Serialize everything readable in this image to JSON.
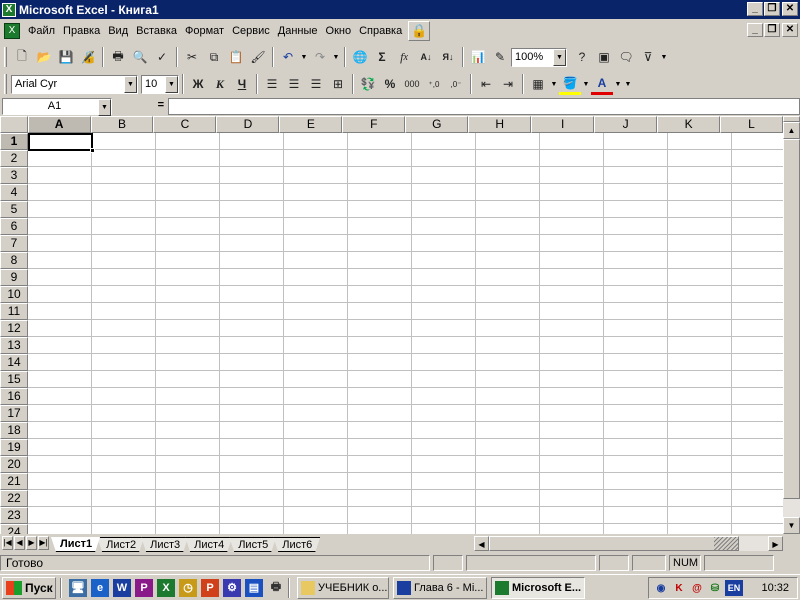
{
  "window": {
    "title": "Microsoft Excel - Книга1",
    "app_icon": "excel-icon"
  },
  "menu": {
    "items": [
      "Файл",
      "Правка",
      "Вид",
      "Вставка",
      "Формат",
      "Сервис",
      "Данные",
      "Окно",
      "Справка"
    ]
  },
  "standard_toolbar": {
    "zoom": "100%"
  },
  "formatting_toolbar": {
    "font_name": "Arial Cyr",
    "font_size": "10",
    "bold_label": "Ж",
    "italic_label": "К",
    "underline_label": "Ч",
    "percent_label": "%",
    "thousands_label": "000"
  },
  "formula_bar": {
    "name_box": "A1",
    "equals": "=",
    "content": ""
  },
  "grid": {
    "columns": [
      "A",
      "B",
      "C",
      "D",
      "E",
      "F",
      "G",
      "H",
      "I",
      "J",
      "K",
      "L"
    ],
    "rows": [
      "1",
      "2",
      "3",
      "4",
      "5",
      "6",
      "7",
      "8",
      "9",
      "10",
      "11",
      "12",
      "13",
      "14",
      "15",
      "16",
      "17",
      "18",
      "19",
      "20",
      "21",
      "22",
      "23",
      "24"
    ],
    "active_cell": "A1"
  },
  "sheet_tabs": [
    "Лист1",
    "Лист2",
    "Лист3",
    "Лист4",
    "Лист5",
    "Лист6"
  ],
  "active_sheet": "Лист1",
  "status": {
    "text": "Готово",
    "num": "NUM"
  },
  "taskbar": {
    "start_label": "Пуск",
    "buttons": [
      "УЧЕБНИК о...",
      "Глава 6 - Mi...",
      "Microsoft E..."
    ],
    "active_button": "Microsoft E...",
    "tray_lang": "EN",
    "clock": "10:32"
  },
  "colors": {
    "titlebar": "#0a246a",
    "face": "#d4d0c8",
    "excel_green": "#1c7a2e"
  }
}
